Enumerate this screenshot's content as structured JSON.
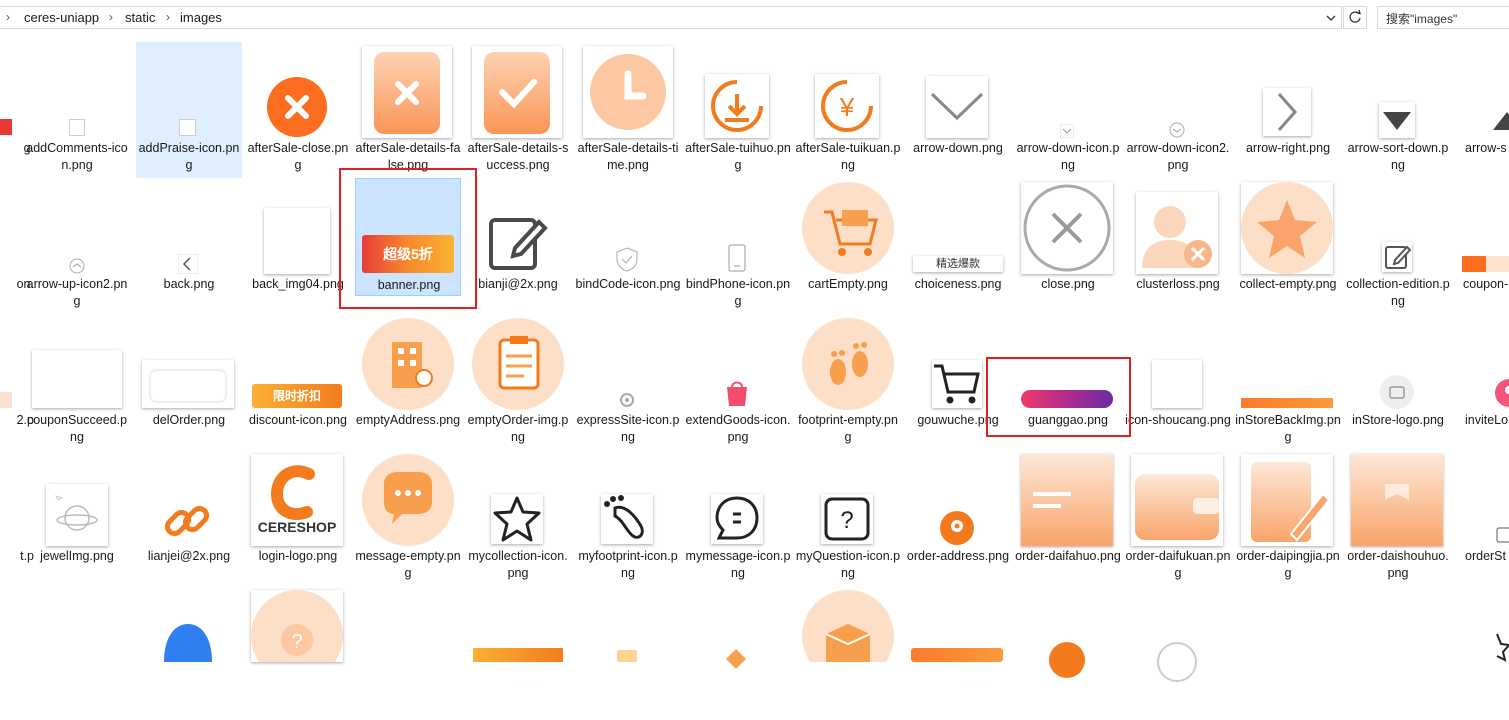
{
  "breadcrumb": [
    "ceres-uniapp",
    "static",
    "images"
  ],
  "search_placeholder": "搜索\"images\"",
  "items": [
    {
      "label": "g.",
      "icon": "red-flag-icon"
    },
    {
      "label": "addComments-icon.png",
      "icon": "small-image-icon"
    },
    {
      "label": "addPraise-icon.png",
      "icon": "small-image-icon"
    },
    {
      "label": "afterSale-close.png",
      "icon": "orange-x-circle-icon"
    },
    {
      "label": "afterSale-details-false.png",
      "icon": "orange-x-bag-icon"
    },
    {
      "label": "afterSale-details-success.png",
      "icon": "orange-check-bag-icon"
    },
    {
      "label": "afterSale-details-time.png",
      "icon": "orange-clock-icon"
    },
    {
      "label": "afterSale-tuihuo.png",
      "icon": "return-icon"
    },
    {
      "label": "afterSale-tuikuan.png",
      "icon": "refund-yen-icon"
    },
    {
      "label": "arrow-down.png",
      "icon": "arrow-down-icon"
    },
    {
      "label": "arrow-down-icon.png",
      "icon": "arrow-down-small-icon"
    },
    {
      "label": "arrow-down-icon2.png",
      "icon": "arrow-down-circle-icon"
    },
    {
      "label": "arrow-right.png",
      "icon": "arrow-right-icon"
    },
    {
      "label": "arrow-sort-down.png",
      "icon": "sort-down-icon"
    },
    {
      "label": "arrow-s pr",
      "icon": "sort-up-icon"
    },
    {
      "label": "on.",
      "icon": "none"
    },
    {
      "label": "arrow-up-icon2.png",
      "icon": "arrow-up-circle-icon"
    },
    {
      "label": "back.png",
      "icon": "back-arrow-icon"
    },
    {
      "label": "back_img04.png",
      "icon": "blank-image-icon"
    },
    {
      "label": "banner.png",
      "icon": "banner-image"
    },
    {
      "label": "bianji@2x.png",
      "icon": "edit-icon"
    },
    {
      "label": "bindCode-icon.png",
      "icon": "shield-icon"
    },
    {
      "label": "bindPhone-icon.png",
      "icon": "phone-icon"
    },
    {
      "label": "cartEmpty.png",
      "icon": "empty-cart-illustration"
    },
    {
      "label": "choiceness.png",
      "icon": "choiceness-banner"
    },
    {
      "label": "close.png",
      "icon": "close-circle-icon"
    },
    {
      "label": "clusterloss.png",
      "icon": "cluster-loss-icon"
    },
    {
      "label": "collect-empty.png",
      "icon": "star-illustration"
    },
    {
      "label": "collection-edition.png",
      "icon": "edit-small-icon"
    },
    {
      "label": "coupon- pn",
      "icon": "coupon-icon"
    },
    {
      "label": "2.p",
      "icon": "none"
    },
    {
      "label": "couponSucceed.png",
      "icon": "blank-image-icon"
    },
    {
      "label": "delOrder.png",
      "icon": "del-order-icon"
    },
    {
      "label": "discount-icon.png",
      "icon": "discount-tag-image"
    },
    {
      "label": "emptyAddress.png",
      "icon": "building-illustration"
    },
    {
      "label": "emptyOrder-img.png",
      "icon": "clipboard-illustration"
    },
    {
      "label": "expressSite-icon.png",
      "icon": "location-small-icon"
    },
    {
      "label": "extendGoods-icon.png",
      "icon": "shopping-bag-icon"
    },
    {
      "label": "footprint-empty.png",
      "icon": "footprint-illustration"
    },
    {
      "label": "gouwuche.png",
      "icon": "cart-icon"
    },
    {
      "label": "guanggao.png",
      "icon": "ad-banner-image"
    },
    {
      "label": "icon-shoucang.png",
      "icon": "blank-image-icon"
    },
    {
      "label": "inStoreBackImg.png",
      "icon": "orange-strip-image"
    },
    {
      "label": "inStore-logo.png",
      "icon": "store-logo-icon"
    },
    {
      "label": "inviteLo",
      "icon": "invite-icon"
    },
    {
      "label": "t.p",
      "icon": "none"
    },
    {
      "label": "jewelImg.png",
      "icon": "planet-illustration"
    },
    {
      "label": "lianjei@2x.png",
      "icon": "link-icon"
    },
    {
      "label": "login-logo.png",
      "icon": "ceres-shop-logo"
    },
    {
      "label": "message-empty.png",
      "icon": "message-illustration"
    },
    {
      "label": "mycollection-icon.png",
      "icon": "star-outline-icon"
    },
    {
      "label": "myfootprint-icon.png",
      "icon": "footprint-icon"
    },
    {
      "label": "mymessage-icon.png",
      "icon": "message-bubble-icon"
    },
    {
      "label": "myQuestion-icon.png",
      "icon": "question-icon"
    },
    {
      "label": "order-address.png",
      "icon": "location-orange-icon"
    },
    {
      "label": "order-daifahuo.png",
      "icon": "card-illustration"
    },
    {
      "label": "order-daifukuan.png",
      "icon": "wallet-illustration"
    },
    {
      "label": "order-daipingjia.png",
      "icon": "pen-illustration"
    },
    {
      "label": "order-daishouhuo.png",
      "icon": "box-illustration"
    },
    {
      "label": "orderSt",
      "icon": "order-small-icon"
    },
    {
      "label": "",
      "icon": "person-icon"
    },
    {
      "label": "",
      "icon": "question-illustration"
    },
    {
      "label": "",
      "icon": "box-open-illustration"
    }
  ],
  "ui": {
    "accent": "#0078d7",
    "selection_bg": "#cce4ff",
    "hover_bg": "#e5f3ff",
    "highlight_red": "#e02020",
    "orange": "#fc7a2c"
  },
  "choiceness_text": "精选爆款",
  "banner_text": "超级5折",
  "logo_text": "CERESHOP",
  "discount_text": "限时折扣"
}
